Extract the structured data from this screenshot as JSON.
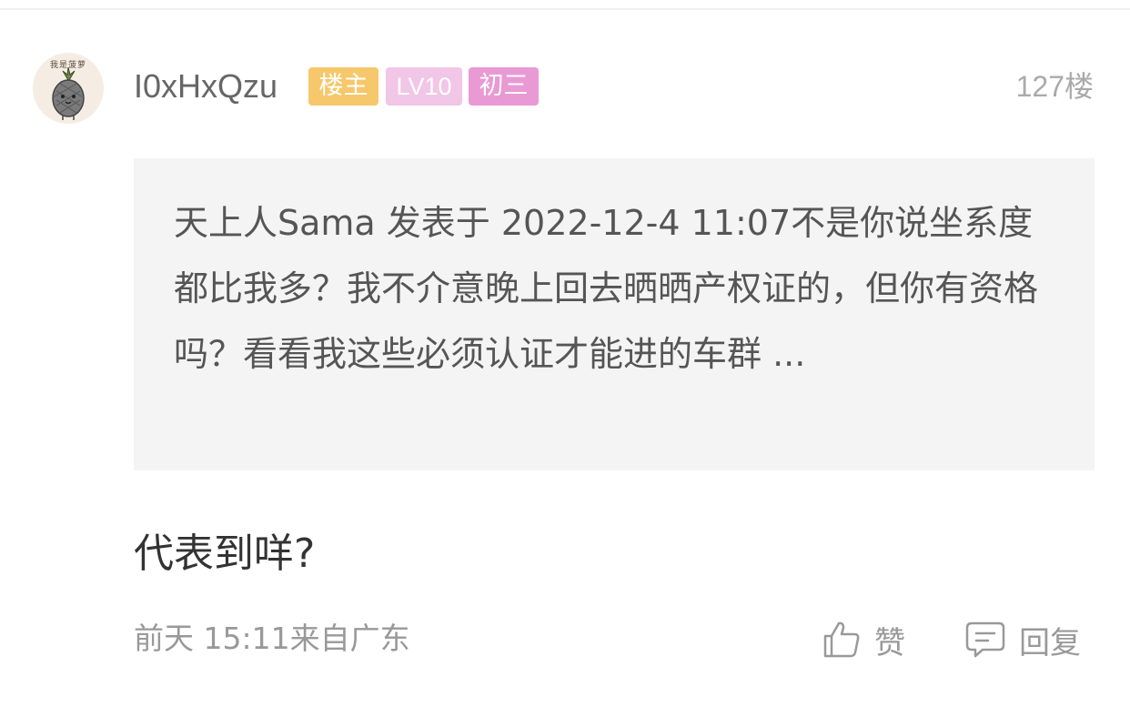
{
  "user": {
    "avatar_text": "我是菠萝",
    "name": "I0xHxQzu",
    "badges": {
      "host": "楼主",
      "level": "LV10",
      "rank": "初三"
    }
  },
  "post": {
    "floor": "127楼",
    "quote": "天上人Sama 发表于 2022-12-4 11:07不是你说坐系度都比我多？我不介意晚上回去晒晒产权证的，但你有资格吗？看看我这些必须认证才能进的车群 ...",
    "reply": "代表到咩?",
    "meta": "前天 15:11来自广东"
  },
  "actions": {
    "like_label": "赞",
    "reply_label": "回复"
  },
  "colors": {
    "host_badge": "#f6c86b",
    "level_badge": "#f1c6e6",
    "rank_badge": "#e99ad4",
    "quote_bg": "#f4f4f4"
  },
  "icons": {
    "avatar": "pineapple-avatar-icon",
    "like": "thumbs-up-icon",
    "reply": "comment-bubble-icon"
  }
}
